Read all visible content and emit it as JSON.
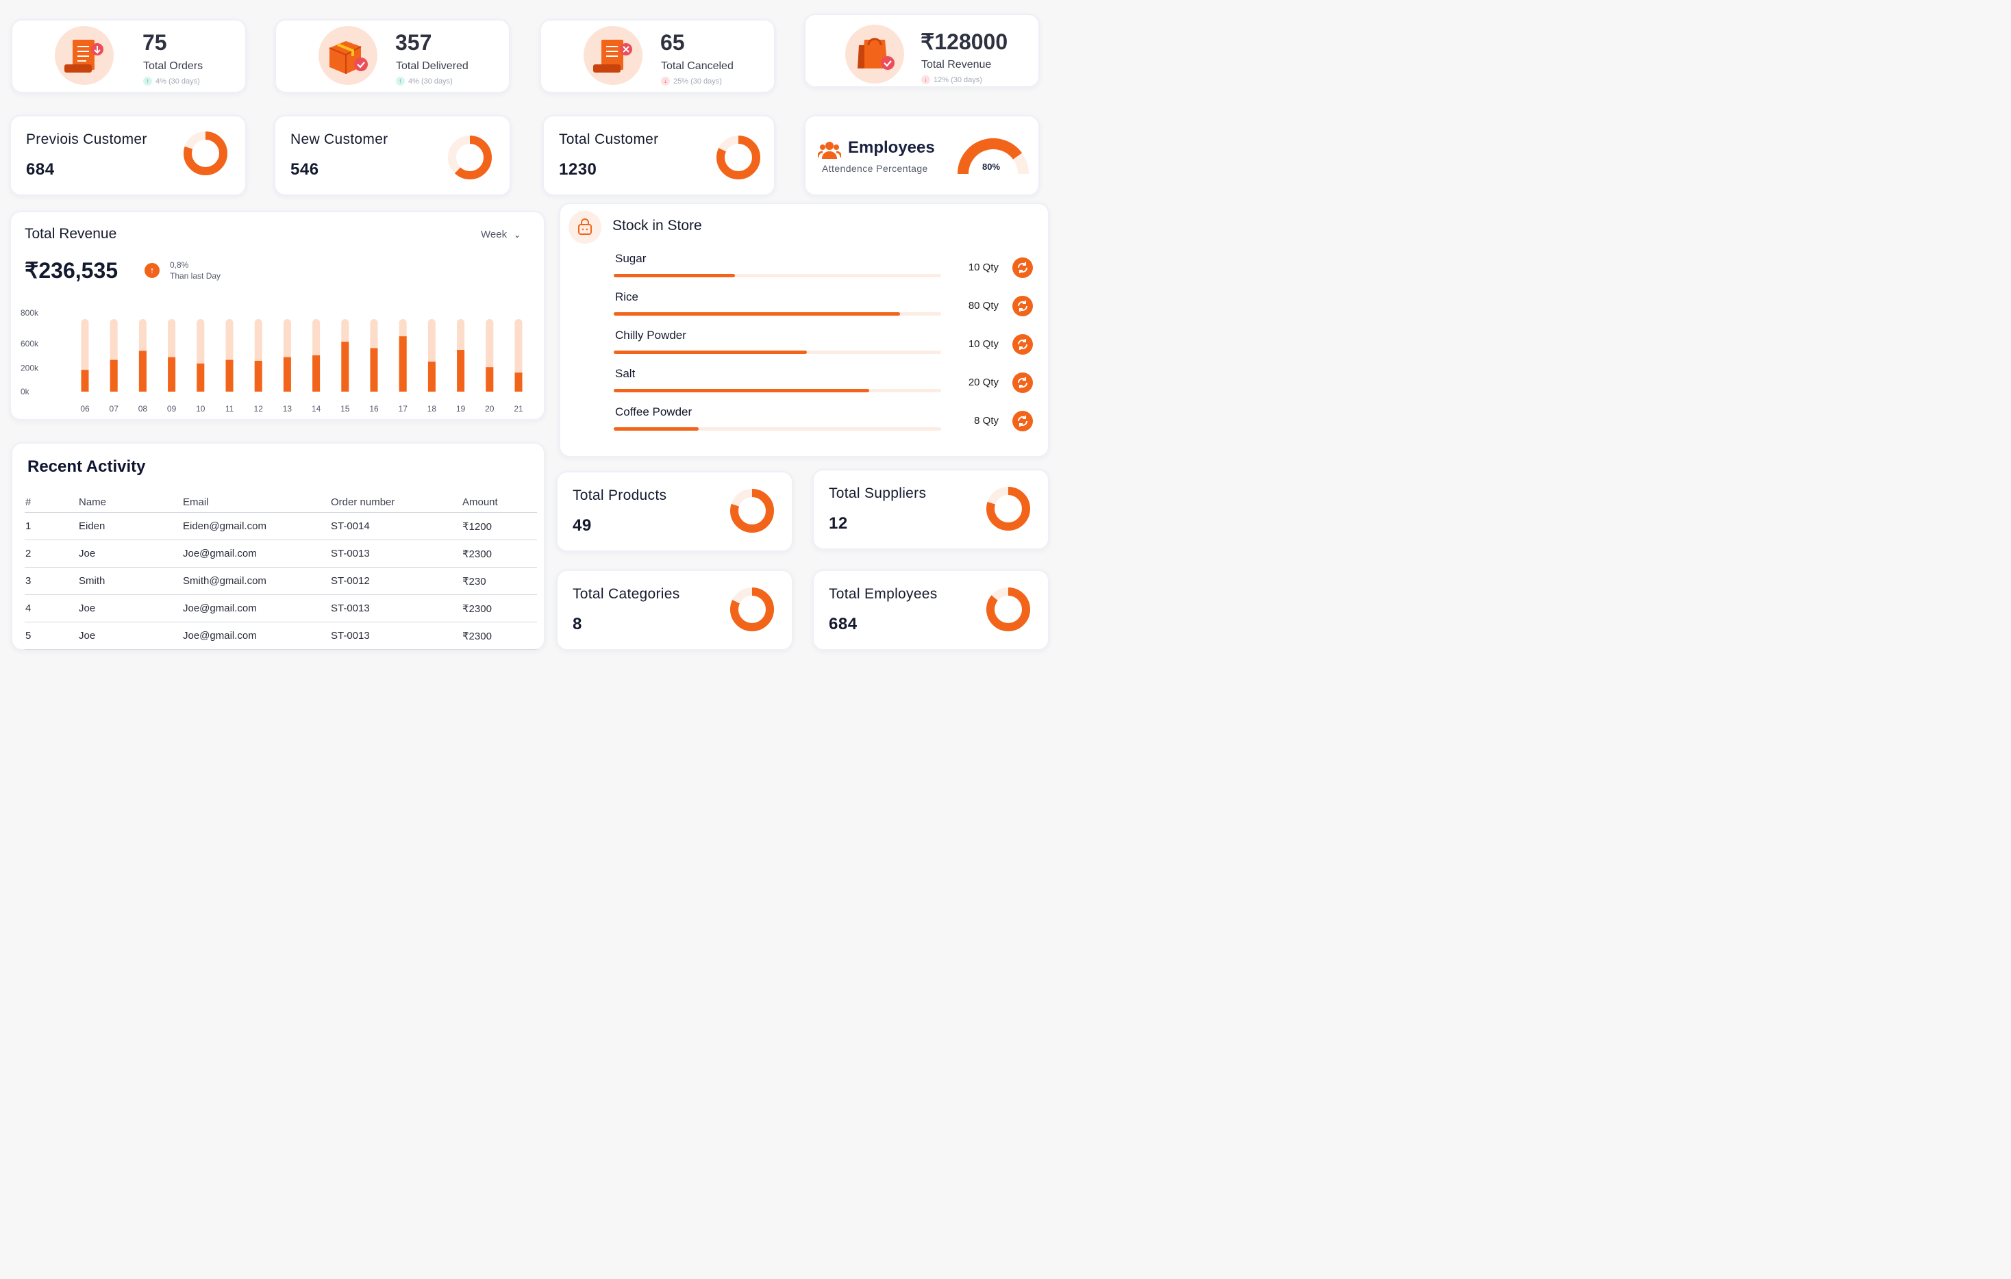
{
  "stats": [
    {
      "value": "75",
      "label": "Total Orders",
      "trend": "4% (30 days)",
      "dir": "up",
      "icon": "orders-icon"
    },
    {
      "value": "357",
      "label": "Total Delivered",
      "trend": "4% (30 days)",
      "dir": "up",
      "icon": "delivered-box-icon"
    },
    {
      "value": "65",
      "label": "Total Canceled",
      "trend": "25% (30 days)",
      "dir": "down",
      "icon": "canceled-icon"
    },
    {
      "value": "₹128000",
      "label": "Total Revenue",
      "trend": "12% (30 days)",
      "dir": "down",
      "icon": "shopping-bag-icon"
    }
  ],
  "customers": [
    {
      "title": "Previois Customer",
      "value": "684",
      "fraction": 0.8
    },
    {
      "title": "New Customer",
      "value": "546",
      "fraction": 0.62
    },
    {
      "title": "Total Customer",
      "value": "1230",
      "fraction": 0.82
    }
  ],
  "employees": {
    "title": "Employees",
    "subtitle": "Attendence Percentage",
    "percent_label": "80%",
    "fraction": 0.8
  },
  "revenue": {
    "title": "Total Revenue",
    "period": "Week",
    "amount": "₹236,535",
    "change": "0,8%",
    "change_note": "Than last Day"
  },
  "chart_data": {
    "type": "bar",
    "categories": [
      "06",
      "07",
      "08",
      "09",
      "10",
      "11",
      "12",
      "13",
      "14",
      "15",
      "16",
      "17",
      "18",
      "19",
      "20",
      "21"
    ],
    "values": [
      240,
      350,
      450,
      380,
      310,
      350,
      340,
      380,
      400,
      550,
      480,
      610,
      330,
      460,
      270,
      210
    ],
    "ylim": [
      0,
      800
    ],
    "yticks": [
      "0k",
      "200k",
      "600k",
      "800k"
    ],
    "accent": "#f26419",
    "track": "#fddcc9"
  },
  "stock": {
    "title": "Stock in Store",
    "items": [
      {
        "name": "Sugar",
        "qty": "10 Qty",
        "level": 0.37
      },
      {
        "name": "Rice",
        "qty": "80 Qty",
        "level": 0.875
      },
      {
        "name": "Chilly Powder",
        "qty": "10 Qty",
        "level": 0.59
      },
      {
        "name": "Salt",
        "qty": "20 Qty",
        "level": 0.78
      },
      {
        "name": "Coffee Powder",
        "qty": "8 Qty",
        "level": 0.26
      }
    ]
  },
  "activity": {
    "title": "Recent Activity",
    "columns": [
      "#",
      "Name",
      "Email",
      "Order number",
      "Amount"
    ],
    "rows": [
      [
        "1",
        "Eiden",
        "Eiden@gmail.com",
        "ST-0014",
        "₹1200"
      ],
      [
        "2",
        "Joe",
        "Joe@gmail.com",
        "ST-0013",
        "₹2300"
      ],
      [
        "3",
        "Smith",
        "Smith@gmail.com",
        "ST-0012",
        "₹230"
      ],
      [
        "4",
        "Joe",
        "Joe@gmail.com",
        "ST-0013",
        "₹2300"
      ],
      [
        "5",
        "Joe",
        "Joe@gmail.com",
        "ST-0013",
        "₹2300"
      ]
    ]
  },
  "totals": [
    {
      "title": "Total Products",
      "value": "49",
      "fraction": 0.8
    },
    {
      "title": "Total Suppliers",
      "value": "12",
      "fraction": 0.8
    },
    {
      "title": "Total Categories",
      "value": "8",
      "fraction": 0.82
    },
    {
      "title": "Total Employees",
      "value": "684",
      "fraction": 0.86
    }
  ],
  "colors": {
    "accent": "#f26419",
    "accent_light": "#fde3d6",
    "ring_track": "#fdeee6"
  }
}
